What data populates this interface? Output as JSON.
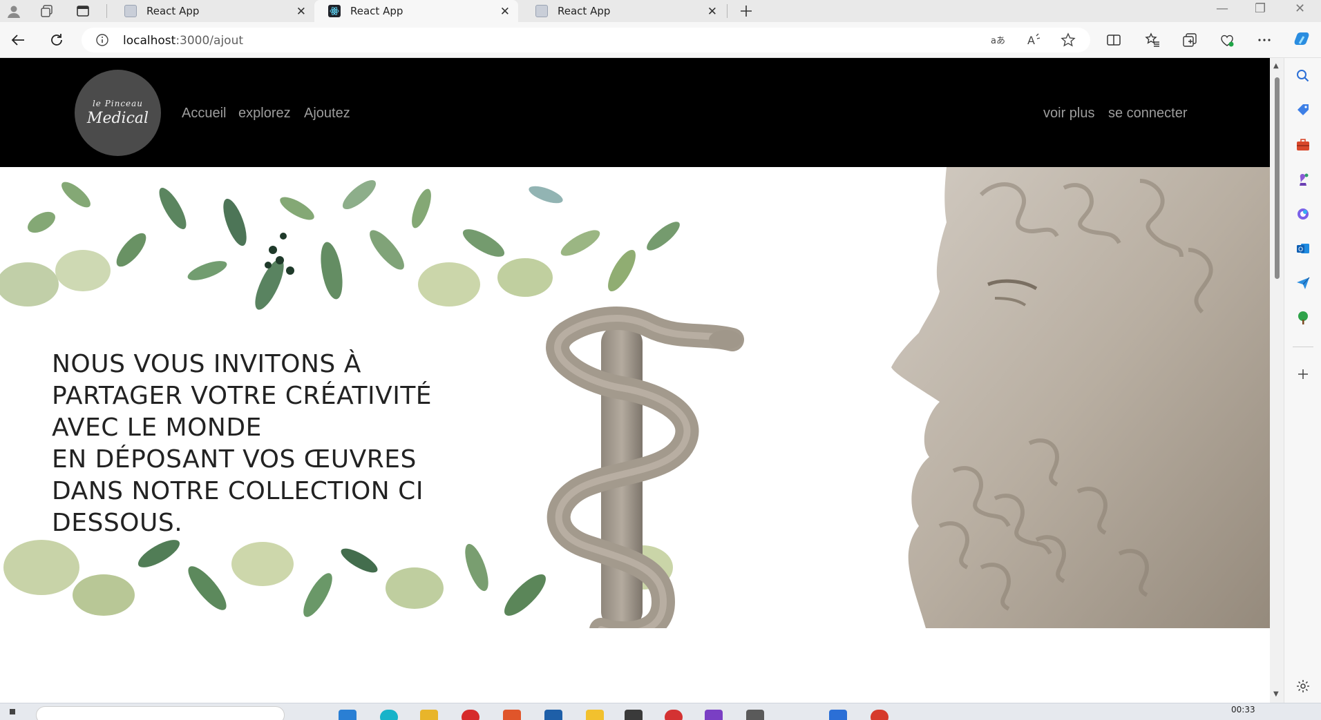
{
  "browser": {
    "tabs": [
      {
        "title": "React App",
        "active": false
      },
      {
        "title": "React App",
        "active": true
      },
      {
        "title": "React App",
        "active": false
      }
    ],
    "address": {
      "host": "localhost",
      "path": ":3000/ajout"
    }
  },
  "nav": {
    "logo": {
      "line1": "le Pinceau",
      "line2": "Medical"
    },
    "left_links": [
      "Accueil",
      "explorez",
      "Ajoutez"
    ],
    "right_links": [
      "voir plus",
      "se connecter"
    ]
  },
  "hero": {
    "lines": [
      "NOUS VOUS INVITONS À",
      "PARTAGER VOTRE CRÉATIVITÉ",
      "AVEC LE MONDE",
      "EN DÉPOSANT VOS ŒUVRES",
      "DANS NOTRE COLLECTION CI",
      "DESSOUS."
    ]
  },
  "taskbar": {
    "time": "00:33"
  },
  "colors": {
    "nav_bg": "#000000",
    "nav_link": "#9d9d9d",
    "logo_bg": "#4b4b4b",
    "leaf_green": "#5d8a55",
    "stone": "#b9afa2"
  }
}
